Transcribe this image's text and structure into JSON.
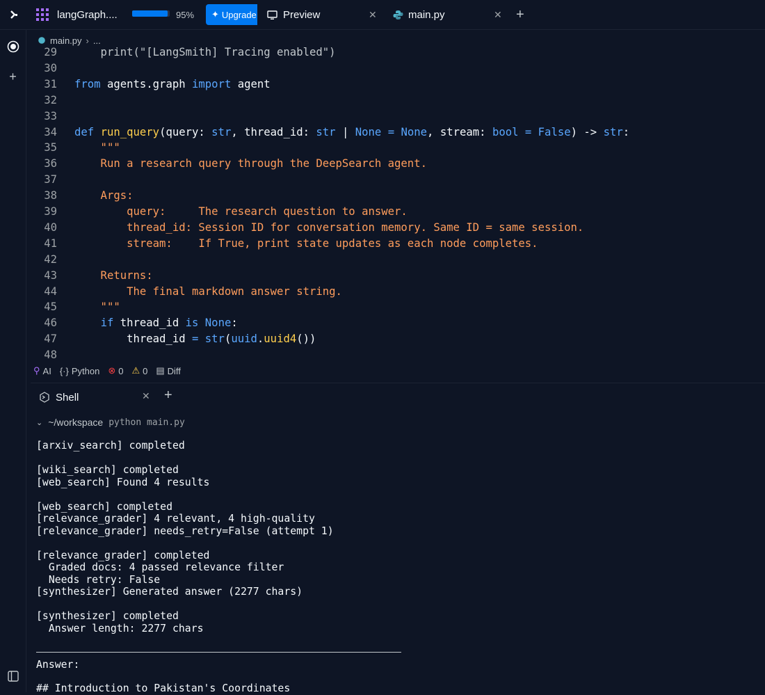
{
  "topbar": {
    "repl_name": "langGraph....",
    "progress_percent": 95,
    "progress_label": "95%",
    "upgrade_label": "Upgrade",
    "tabs": [
      {
        "label": "Preview",
        "icon": "monitor-icon"
      },
      {
        "label": "main.py",
        "icon": "python-icon"
      }
    ]
  },
  "breadcrumb": {
    "file": "main.py",
    "ellipsis": "..."
  },
  "code_lines": [
    {
      "n": "29",
      "tokens": [
        {
          "t": "    print(\"[LangSmith] Tracing enabled\")",
          "c": "dim"
        }
      ]
    },
    {
      "n": "30",
      "tokens": []
    },
    {
      "n": "31",
      "tokens": [
        {
          "t": "from ",
          "c": "kw"
        },
        {
          "t": "agents.graph ",
          "c": "plain"
        },
        {
          "t": "import ",
          "c": "kw"
        },
        {
          "t": "agent",
          "c": "plain"
        }
      ]
    },
    {
      "n": "32",
      "tokens": []
    },
    {
      "n": "33",
      "tokens": []
    },
    {
      "n": "34",
      "tokens": [
        {
          "t": "def ",
          "c": "kw"
        },
        {
          "t": "run_query",
          "c": "fn"
        },
        {
          "t": "(query: ",
          "c": "plain"
        },
        {
          "t": "str",
          "c": "kw"
        },
        {
          "t": ", thread_id: ",
          "c": "plain"
        },
        {
          "t": "str ",
          "c": "kw"
        },
        {
          "t": "| ",
          "c": "plain"
        },
        {
          "t": "None ",
          "c": "kw"
        },
        {
          "t": "= ",
          "c": "kw"
        },
        {
          "t": "None",
          "c": "kw"
        },
        {
          "t": ", stream: ",
          "c": "plain"
        },
        {
          "t": "bool ",
          "c": "kw"
        },
        {
          "t": "= ",
          "c": "kw"
        },
        {
          "t": "False",
          "c": "kw"
        },
        {
          "t": ") -> ",
          "c": "plain"
        },
        {
          "t": "str",
          "c": "kw"
        },
        {
          "t": ":",
          "c": "plain"
        }
      ]
    },
    {
      "n": "35",
      "tokens": [
        {
          "t": "    \"\"\"",
          "c": "str"
        }
      ]
    },
    {
      "n": "36",
      "tokens": [
        {
          "t": "    Run a research query through the DeepSearch agent.",
          "c": "str"
        }
      ]
    },
    {
      "n": "37",
      "tokens": []
    },
    {
      "n": "38",
      "tokens": [
        {
          "t": "    Args:",
          "c": "str"
        }
      ]
    },
    {
      "n": "39",
      "tokens": [
        {
          "t": "        query:     The research question to answer.",
          "c": "str"
        }
      ]
    },
    {
      "n": "40",
      "tokens": [
        {
          "t": "        thread_id: Session ID for conversation memory. Same ID = same session.",
          "c": "str"
        }
      ]
    },
    {
      "n": "41",
      "tokens": [
        {
          "t": "        stream:    If True, print state updates as each node completes.",
          "c": "str"
        }
      ]
    },
    {
      "n": "42",
      "tokens": []
    },
    {
      "n": "43",
      "tokens": [
        {
          "t": "    Returns:",
          "c": "str"
        }
      ]
    },
    {
      "n": "44",
      "tokens": [
        {
          "t": "        The final markdown answer string.",
          "c": "str"
        }
      ]
    },
    {
      "n": "45",
      "tokens": [
        {
          "t": "    \"\"\"",
          "c": "str"
        }
      ]
    },
    {
      "n": "46",
      "tokens": [
        {
          "t": "    ",
          "c": "plain"
        },
        {
          "t": "if ",
          "c": "kw"
        },
        {
          "t": "thread_id ",
          "c": "plain"
        },
        {
          "t": "is ",
          "c": "kw"
        },
        {
          "t": "None",
          "c": "kw"
        },
        {
          "t": ":",
          "c": "plain"
        }
      ]
    },
    {
      "n": "47",
      "tokens": [
        {
          "t": "        thread_id ",
          "c": "plain"
        },
        {
          "t": "= ",
          "c": "kw"
        },
        {
          "t": "str",
          "c": "kw"
        },
        {
          "t": "(",
          "c": "plain"
        },
        {
          "t": "uuid",
          "c": "kw"
        },
        {
          "t": ".",
          "c": "plain"
        },
        {
          "t": "uuid4",
          "c": "fn"
        },
        {
          "t": "())",
          "c": "plain"
        }
      ]
    },
    {
      "n": "48",
      "tokens": []
    }
  ],
  "statusbar": {
    "ai": "AI",
    "language": "Python",
    "errors": "0",
    "warnings": "0",
    "diff": "Diff"
  },
  "shell": {
    "tab_label": "Shell",
    "prompt_path": "~/workspace",
    "prompt_command": "python main.py",
    "lines": [
      "[arxiv_search] completed",
      "",
      "[wiki_search] completed",
      "[web_search] Found 4 results",
      "",
      "[web_search] completed",
      "[relevance_grader] 4 relevant, 4 high-quality",
      "[relevance_grader] needs_retry=False (attempt 1)",
      "",
      "[relevance_grader] completed",
      "  Graded docs: 4 passed relevance filter",
      "  Needs retry: False",
      "[synthesizer] Generated answer (2277 chars)",
      "",
      "[synthesizer] completed",
      "  Answer length: 2277 chars"
    ],
    "answer_label": "Answer:",
    "answer_heading": "## Introduction to Pakistan's Coordinates"
  },
  "colors": {
    "background": "#0e1525",
    "keyword": "#5aa7ff",
    "function": "#ffcf4d",
    "string": "#ff9d5c",
    "accent": "#0079f2"
  }
}
